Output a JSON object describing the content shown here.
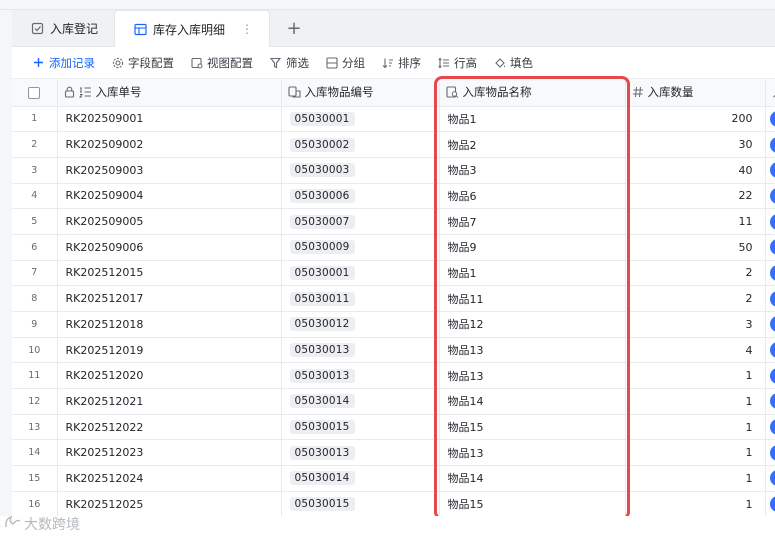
{
  "top": {
    "text": ""
  },
  "tabs": [
    {
      "label": "入库登记",
      "active": false,
      "icon": "form-icon"
    },
    {
      "label": "库存入库明细",
      "active": true,
      "icon": "table-icon",
      "more": "⋮"
    }
  ],
  "tab_add": "+",
  "toolbar": {
    "add_record": "添加记录",
    "field_config": "字段配置",
    "view_config": "视图配置",
    "filter": "筛选",
    "group": "分组",
    "sort": "排序",
    "row_height": "行高",
    "fill_color": "填色"
  },
  "columns": {
    "order_no": "入库单号",
    "item_code": "入库物品编号",
    "item_name": "入库物品名称",
    "quantity": "入库数量"
  },
  "rows": [
    {
      "idx": "1",
      "order_no": "RK202509001",
      "item_code": "05030001",
      "item_name": "物品1",
      "quantity": "200"
    },
    {
      "idx": "2",
      "order_no": "RK202509002",
      "item_code": "05030002",
      "item_name": "物品2",
      "quantity": "30"
    },
    {
      "idx": "3",
      "order_no": "RK202509003",
      "item_code": "05030003",
      "item_name": "物品3",
      "quantity": "40"
    },
    {
      "idx": "4",
      "order_no": "RK202509004",
      "item_code": "05030006",
      "item_name": "物品6",
      "quantity": "22"
    },
    {
      "idx": "5",
      "order_no": "RK202509005",
      "item_code": "05030007",
      "item_name": "物品7",
      "quantity": "11"
    },
    {
      "idx": "6",
      "order_no": "RK202509006",
      "item_code": "05030009",
      "item_name": "物品9",
      "quantity": "50"
    },
    {
      "idx": "7",
      "order_no": "RK202512015",
      "item_code": "05030001",
      "item_name": "物品1",
      "quantity": "2"
    },
    {
      "idx": "8",
      "order_no": "RK202512017",
      "item_code": "05030011",
      "item_name": "物品11",
      "quantity": "2"
    },
    {
      "idx": "9",
      "order_no": "RK202512018",
      "item_code": "05030012",
      "item_name": "物品12",
      "quantity": "3"
    },
    {
      "idx": "10",
      "order_no": "RK202512019",
      "item_code": "05030013",
      "item_name": "物品13",
      "quantity": "4"
    },
    {
      "idx": "11",
      "order_no": "RK202512020",
      "item_code": "05030013",
      "item_name": "物品13",
      "quantity": "1"
    },
    {
      "idx": "12",
      "order_no": "RK202512021",
      "item_code": "05030014",
      "item_name": "物品14",
      "quantity": "1"
    },
    {
      "idx": "13",
      "order_no": "RK202512022",
      "item_code": "05030015",
      "item_name": "物品15",
      "quantity": "1"
    },
    {
      "idx": "14",
      "order_no": "RK202512023",
      "item_code": "05030013",
      "item_name": "物品13",
      "quantity": "1"
    },
    {
      "idx": "15",
      "order_no": "RK202512024",
      "item_code": "05030014",
      "item_name": "物品14",
      "quantity": "1"
    },
    {
      "idx": "16",
      "order_no": "RK202512025",
      "item_code": "05030015",
      "item_name": "物品15",
      "quantity": "1"
    }
  ],
  "watermark": {
    "text": ""
  },
  "bottom_logo": "大数跨境",
  "colors": {
    "accent": "#1664ff",
    "highlight": "#e5484d",
    "cell_tag": "#eceef1"
  }
}
